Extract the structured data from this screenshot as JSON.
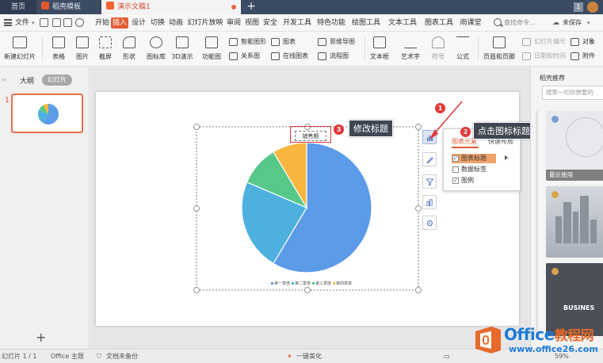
{
  "tabs": {
    "home": "首页",
    "template": "稻壳模板",
    "doc": "演示文稿1",
    "add": "+",
    "page_badge": "1"
  },
  "menu": {
    "file": "文件",
    "tabs": [
      "开始",
      "插入",
      "设计",
      "切换",
      "动画",
      "幻灯片放映",
      "审阅",
      "视图",
      "安全",
      "开发工具",
      "特色功能",
      "绘图工具",
      "文本工具",
      "图表工具",
      "雨课堂"
    ],
    "active_tab": "插入",
    "search": "查找命令...",
    "unsaved": "未保存"
  },
  "ribbon": {
    "new_slide": "新建幻灯片",
    "table": "表格",
    "picture": "图片",
    "screenshot": "截屏",
    "shape": "形状",
    "icon_lib": "图标库",
    "3d": "3D演示",
    "func_chart": "功能图",
    "smart_graphic": "智能图形",
    "chart": "图表",
    "mind_map": "思维导图",
    "relation": "关系图",
    "online_chart": "在线图表",
    "flowchart": "流程图",
    "textbox": "文本框",
    "art_text": "艺术字",
    "symbol": "符号",
    "formula": "公式",
    "header_footer": "页眉和页脚",
    "slide_number": "幻灯片编号",
    "datetime": "日期和时间",
    "object": "对象",
    "attachment": "附件"
  },
  "left_panel": {
    "outline_tab": "大纲",
    "slides_tab": "幻灯片",
    "slide_number": "1",
    "add": "+"
  },
  "chart": {
    "title": "销售额",
    "popup_header": "图表元素",
    "popup_header2": "快速布局",
    "popup_items": [
      "图表标题",
      "数据标签",
      "图例"
    ]
  },
  "chart_data": {
    "type": "pie",
    "title": "销售额",
    "categories": [
      "第一季度",
      "第二季度",
      "第三季度",
      "第四季度"
    ],
    "values": [
      8.2,
      3.2,
      1.4,
      1.2
    ],
    "colors": [
      "#5b9be8",
      "#4eb0de",
      "#57c78a",
      "#f7b73f"
    ],
    "legend": "bottom"
  },
  "callouts": {
    "n1": "1",
    "n2": "2",
    "n3": "3",
    "text2": "点击图标标题",
    "text3": "修改标题"
  },
  "right_panel": {
    "title": "稻壳推荐",
    "search_placeholder": "搜索一切你想要的",
    "recent": "最近使用",
    "card3_text": "BUSINES"
  },
  "status": {
    "slide_info": "幻灯片 1 / 1",
    "theme": "Office 主题",
    "backup": "文档未备份",
    "beautify": "一键美化",
    "zoom": "59%"
  },
  "watermark": {
    "brand": "Office",
    "brand_cn": "教程网",
    "url": "www.office26.com"
  },
  "colors": {
    "accent": "#e25e34",
    "callout_red": "#e0393a",
    "title_bar": "#3b4b62"
  }
}
